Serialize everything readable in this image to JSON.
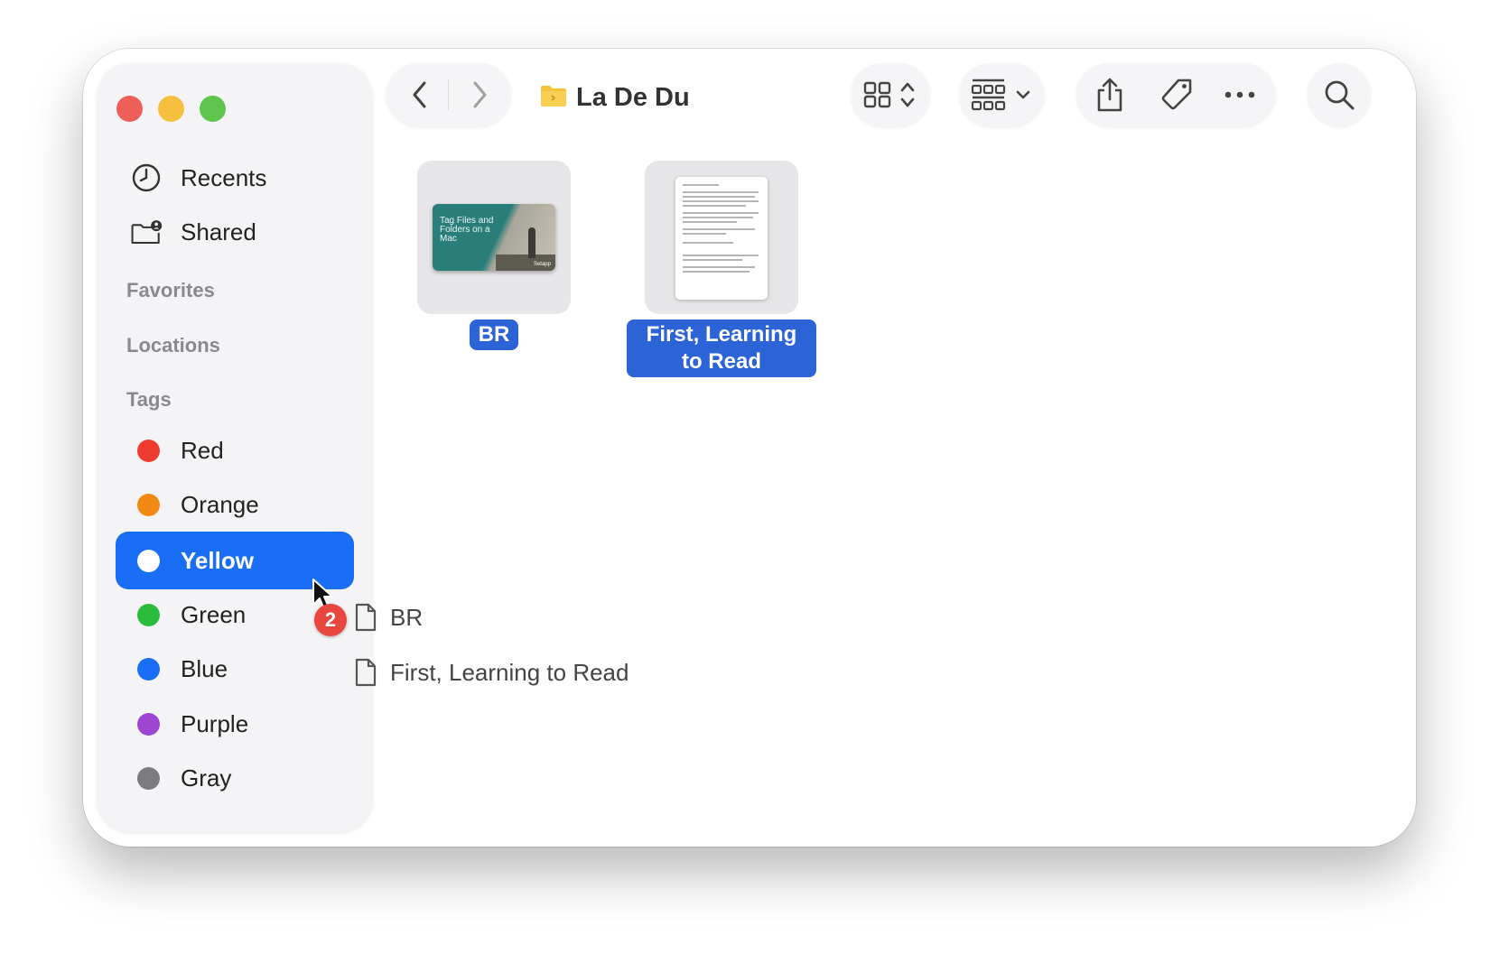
{
  "window": {
    "title": "La De Du"
  },
  "sidebar": {
    "items": [
      {
        "label": "Recents",
        "icon": "clock-icon"
      },
      {
        "label": "Shared",
        "icon": "shared-folder-icon"
      }
    ],
    "sections": {
      "favorites": "Favorites",
      "locations": "Locations",
      "tags": "Tags"
    },
    "tags": [
      {
        "label": "Red",
        "color": "#ee3b2f"
      },
      {
        "label": "Orange",
        "color": "#f08a14"
      },
      {
        "label": "Yellow",
        "color": "#f5c400",
        "selected": true
      },
      {
        "label": "Green",
        "color": "#2bbc3b"
      },
      {
        "label": "Blue",
        "color": "#1a6ef5"
      },
      {
        "label": "Purple",
        "color": "#9d46d1"
      },
      {
        "label": "Gray",
        "color": "#7b7b80"
      }
    ]
  },
  "files": [
    {
      "name": "BR",
      "thumbnail_text": "Tag Files and Folders on a Mac",
      "thumbnail_logo": "Setapp"
    },
    {
      "name": "First, Learning to Read"
    }
  ],
  "drag": {
    "count": "2",
    "items": [
      "BR",
      "First, Learning to Read"
    ]
  },
  "colors": {
    "accent": "#1a6ef5",
    "selection": "#2c63d7",
    "badge": "#e9463f",
    "folder": "#f5c33b"
  }
}
